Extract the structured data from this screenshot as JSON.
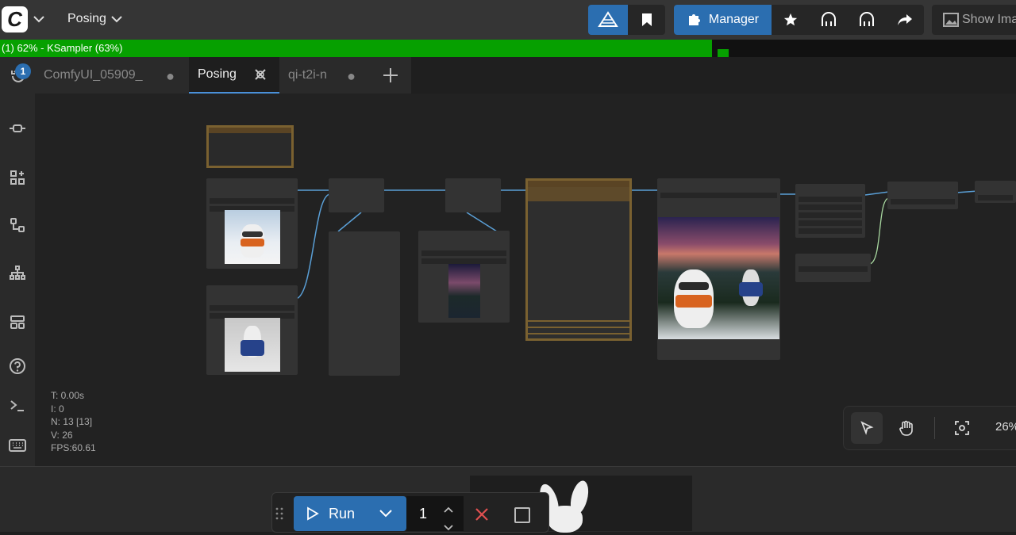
{
  "app": {
    "logo_text": "C",
    "workflow_menu": "Posing"
  },
  "toolbar": {
    "manager_label": "Manager",
    "show_image_label": "Show Ima",
    "accent_color": "#2b6eb0"
  },
  "progress": {
    "text": "(1) 62% - KSampler (63%)",
    "fraction": 0.62,
    "fill_color": "#06a000"
  },
  "tabs": [
    {
      "label": "ComfyUI_05909_",
      "active": false
    },
    {
      "label": "Posing",
      "active": true
    },
    {
      "label": "qi-t2i-n",
      "active": false
    }
  ],
  "sidebar": {
    "queue_badge": "1"
  },
  "stats": {
    "time": "T: 0.00s",
    "i": "I: 0",
    "nodes": "N: 13 [13]",
    "vertices": "V: 26",
    "fps": "FPS:60.61"
  },
  "zoom": {
    "percent": "26%"
  },
  "run": {
    "label": "Run",
    "count": "1"
  }
}
